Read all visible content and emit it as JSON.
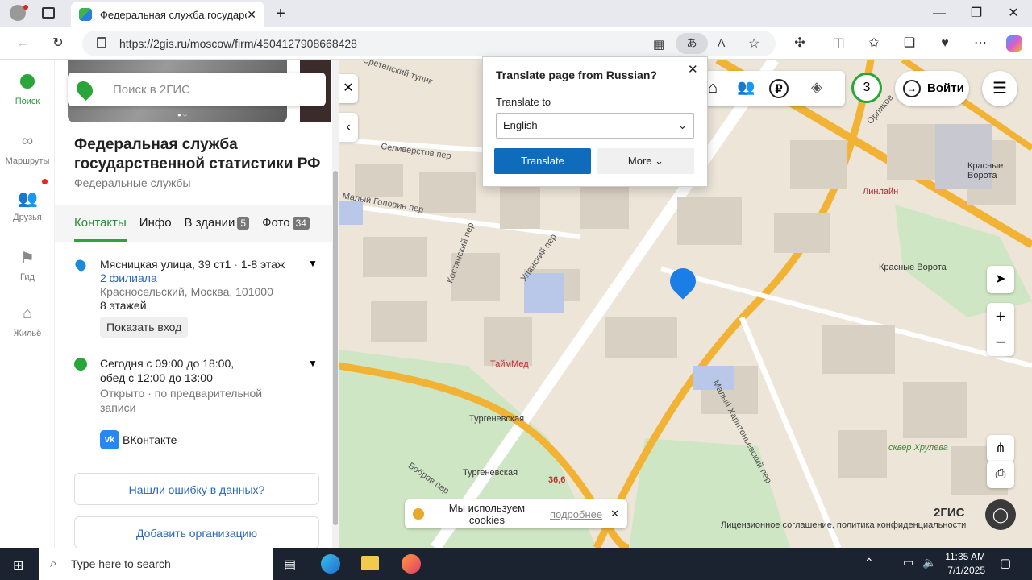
{
  "browser": {
    "tab_title": "Федеральная служба государств",
    "url": "https://2gis.ru/moscow/firm/4504127908668428"
  },
  "rail": [
    {
      "label": "Поиск"
    },
    {
      "label": "Маршруты"
    },
    {
      "label": "Друзья"
    },
    {
      "label": "Гид"
    },
    {
      "label": "Жильё"
    }
  ],
  "search": {
    "placeholder": "Поиск в 2ГИС"
  },
  "org": {
    "name": "Федеральная служба государственной статистики РФ",
    "category": "Федеральные службы"
  },
  "tabs": [
    {
      "label": "Контакты"
    },
    {
      "label": "Инфо"
    },
    {
      "label": "В здании",
      "badge": "5"
    },
    {
      "label": "Фото",
      "badge": "34"
    }
  ],
  "address": {
    "street": "Мясницкая улица, 39 ст1",
    "floor": "1-8 этаж",
    "branches": "2 филиала",
    "city": "Красносельский, Москва, 101000",
    "floors": "8 этажей",
    "show_entrance": "Показать вход"
  },
  "hours": {
    "line1": "Сегодня с 09:00 до 18:00,",
    "line2": "обед с 12:00 до 13:00",
    "status": "Открыто · по предварительной",
    "status2": "записи"
  },
  "social": {
    "label": "ВКонтакте"
  },
  "buttons": {
    "error": "Нашли ошибку в данных?",
    "add": "Добавить организацию"
  },
  "map": {
    "login": "Войти",
    "counter": "3",
    "cookies": "Мы используем cookies",
    "more": "подробнее",
    "brand": "2ГИС",
    "license": "Лицензионное соглашение, политика конфиденциальности",
    "labels": [
      "Сретенский тупик",
      "Селивёрстов пер",
      "Малый Головин пер",
      "Костянский пер",
      "Уланский пер",
      "ТаймМед",
      "Тургеневская",
      "Тургеневская",
      "Бобров пер",
      "Малый Харитоньевский пер",
      "Красные Ворота",
      "Красные Ворота",
      "Линлайн",
      "Орликов",
      "сквер Хрулева",
      "36,6"
    ]
  },
  "translate": {
    "title": "Translate page from Russian?",
    "label": "Translate to",
    "language": "English",
    "translate_btn": "Translate",
    "more_btn": "More"
  },
  "taskbar": {
    "search_placeholder": "Type here to search",
    "time": "11:35 AM",
    "date": "7/1/2025"
  }
}
